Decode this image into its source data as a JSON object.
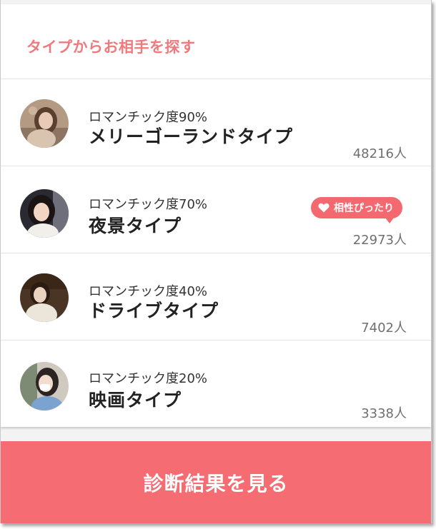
{
  "section": {
    "title": "タイプからお相手を探す"
  },
  "types": [
    {
      "degree": "ロマンチック度90%",
      "name": "メリーゴーランドタイプ",
      "count": "48216人"
    },
    {
      "degree": "ロマンチック度70%",
      "name": "夜景タイプ",
      "count": "22973人"
    },
    {
      "degree": "ロマンチック度40%",
      "name": "ドライブタイプ",
      "count": "7402人"
    },
    {
      "degree": "ロマンチック度20%",
      "name": "映画タイプ",
      "count": "3338人"
    }
  ],
  "badge": {
    "label": "相性ぴったり",
    "icon": "heart-icon"
  },
  "cta": {
    "label": "診断結果を見る"
  },
  "colors": {
    "accent": "#f56d72",
    "title": "#ef7a7e",
    "count": "#6f6f6f"
  }
}
